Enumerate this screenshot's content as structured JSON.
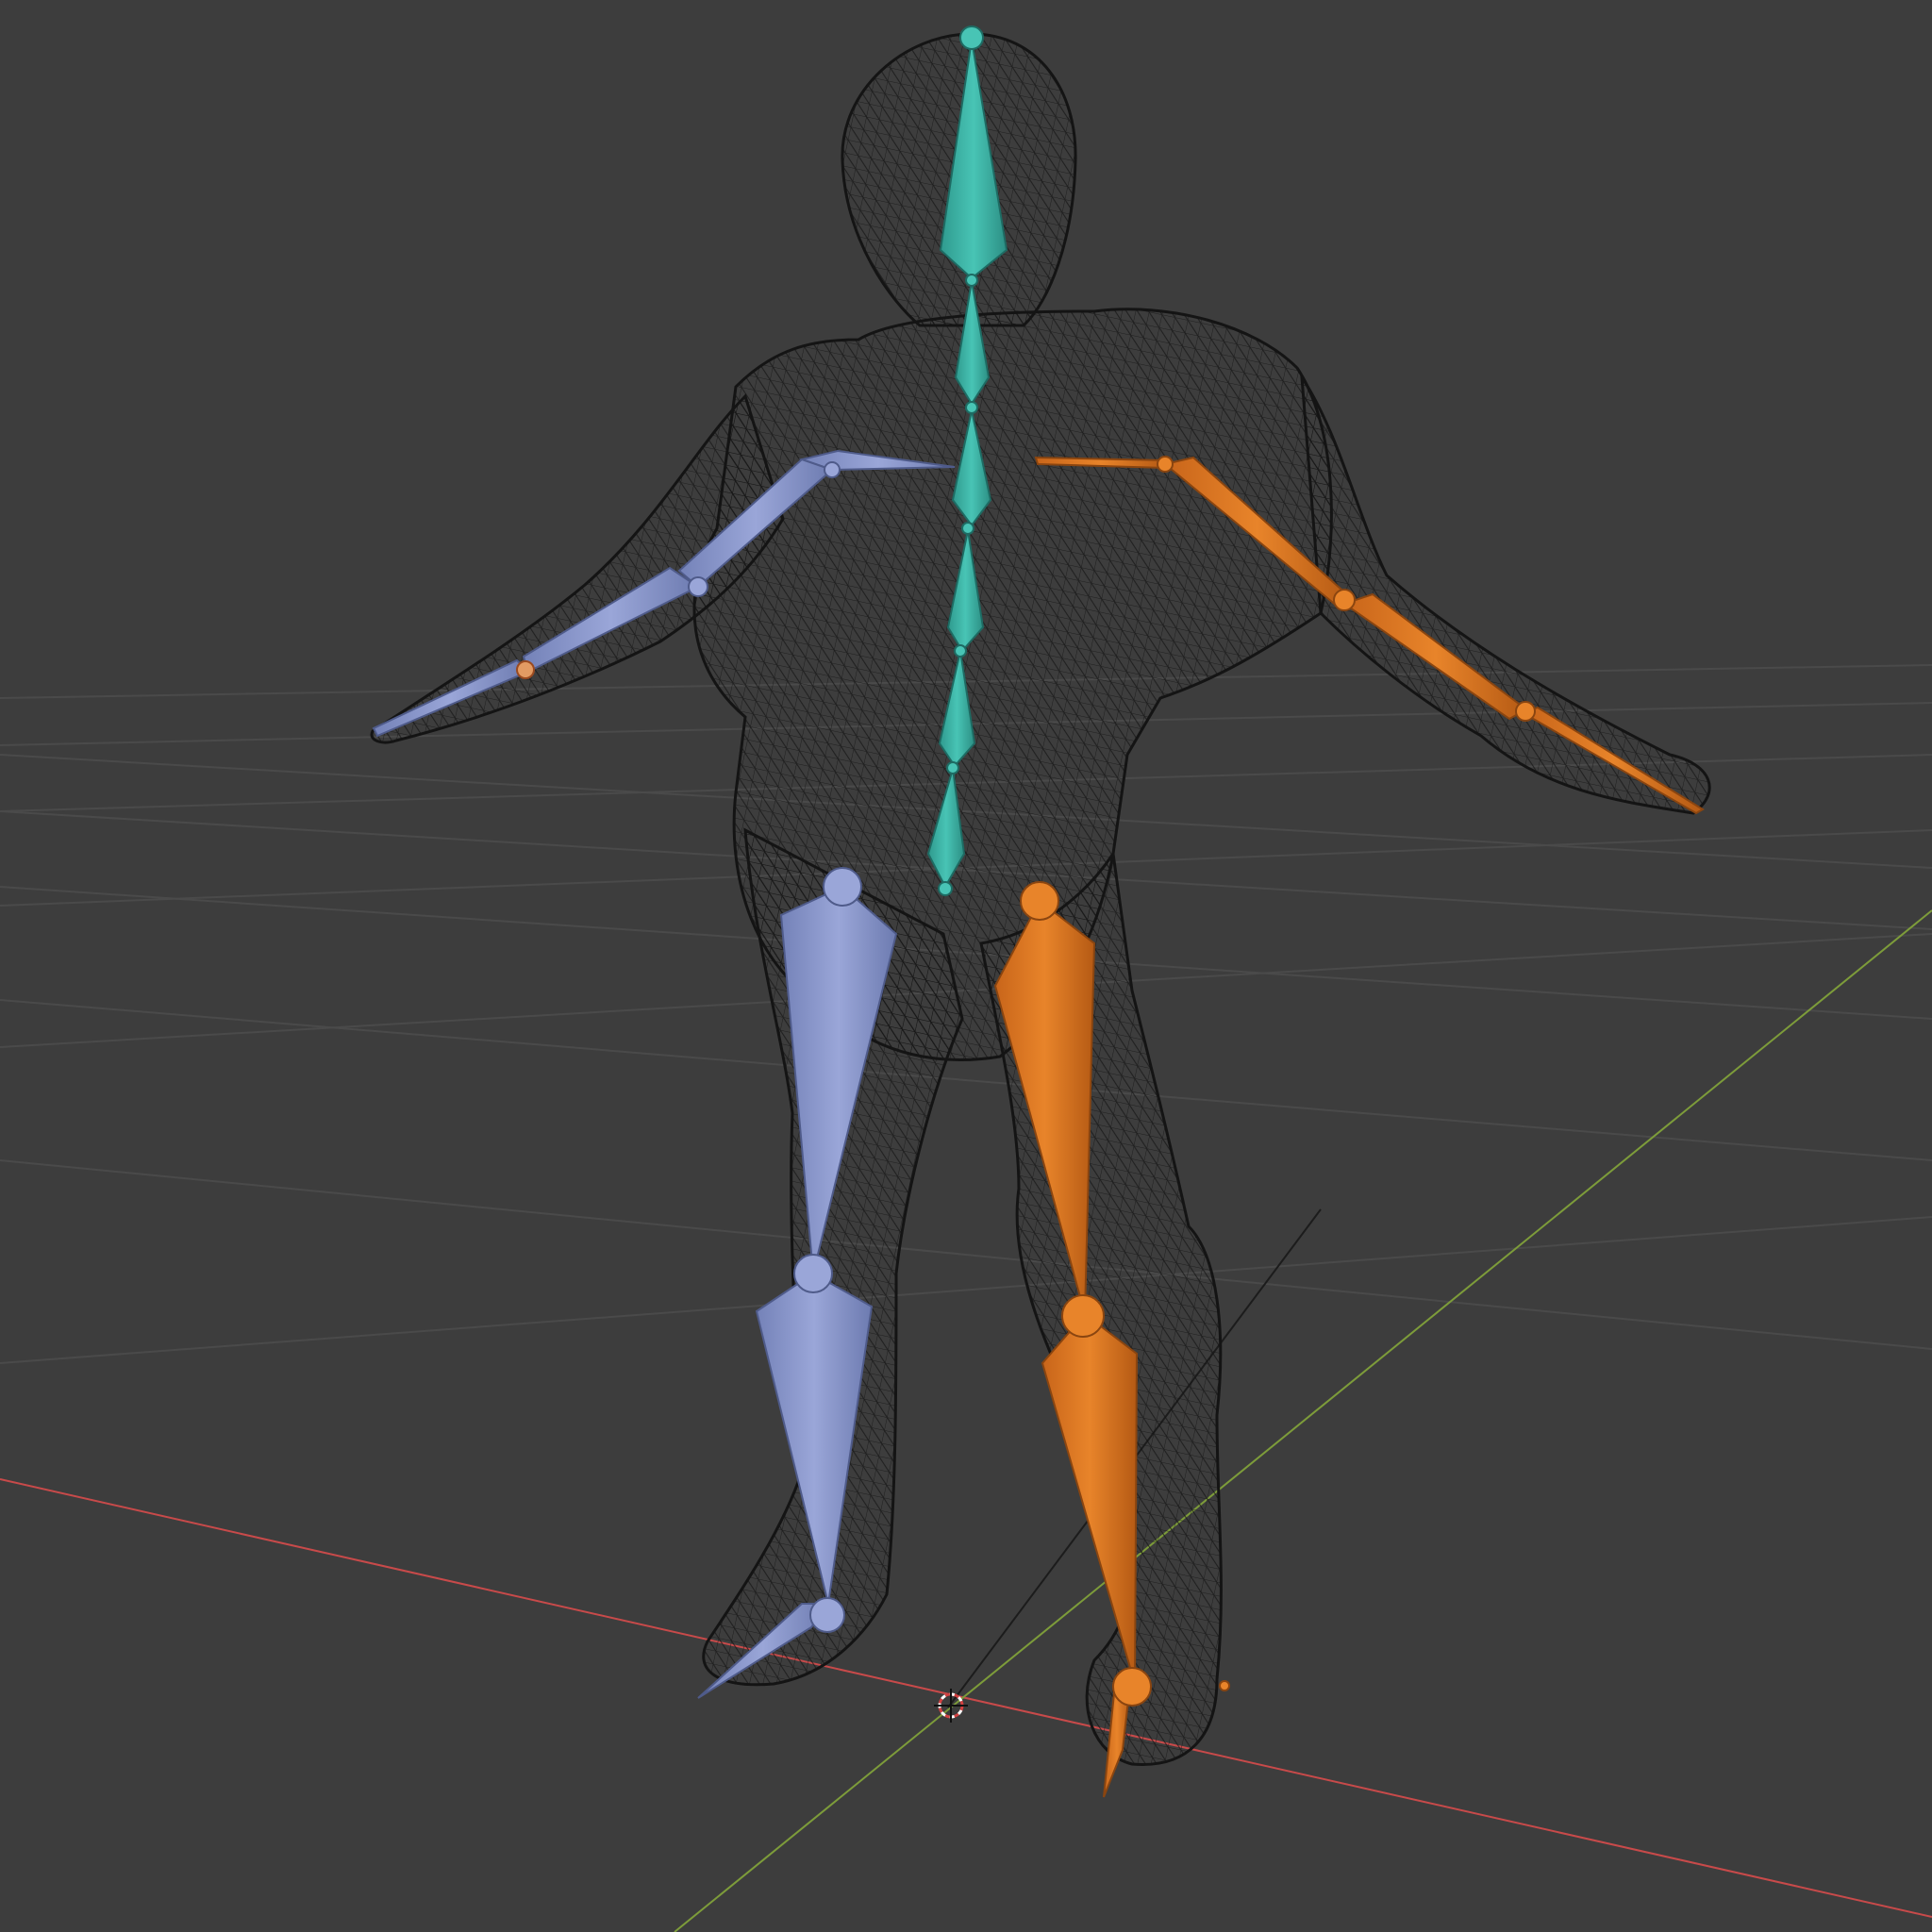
{
  "viewport": {
    "background": "#3d3d3d",
    "grid_color": "#4a4a4a",
    "x_axis_color": "#c84a4a",
    "y_axis_color": "#7d9c3a"
  },
  "wireframe": {
    "color": "#141414"
  },
  "armature": {
    "spine_color": "#3db3a5",
    "left_side_color": "#8793c8",
    "right_side_color": "#df7a22"
  },
  "icons": [
    "3d-cursor-icon"
  ]
}
